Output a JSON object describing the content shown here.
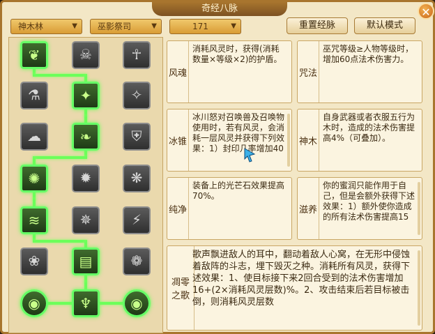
{
  "title": "奇经八脉",
  "dropdowns": [
    {
      "value": "神木林"
    },
    {
      "value": "巫影祭司"
    },
    {
      "value": "171"
    }
  ],
  "buttons": {
    "reset": "重置经脉",
    "default": "默认模式"
  },
  "skills": [
    {
      "name": "风魂",
      "desc": "消耗风灵时，获得(消耗数量×等级×2)的护盾。"
    },
    {
      "name": "咒法",
      "desc": "巫咒等级≥人物等级时，增加60点法术伤害力。"
    },
    {
      "name": "冰锥",
      "desc": "冰川怒对召唤兽及召唤物使用时，若有风灵，会消耗一层风灵并获得下列效果：1）封印几率增加40"
    },
    {
      "name": "神木",
      "desc": "自身武器或者衣服五行为木时，造成的法术伤害提高4%（可叠加）。"
    },
    {
      "name": "纯净",
      "desc": "装备上的光芒石效果提高70%。"
    },
    {
      "name": "滋养",
      "desc": "你的蜜润只能作用于自己，但是会额外获得下述效果：1）额外使你造成的所有法术伤害提高15"
    },
    {
      "name": "凋零之歌",
      "desc": "歌声飘进敌人的耳中，翻动着敌人心窝，在无形中侵蚀着敌阵的斗志，埋下毁灭之种。消耗所有风灵，获得下述效果：1、使目标接下来2回合受到的法术伤害增加16+(2×消耗风灵层数)%。2、攻击结束后若目标被击倒，则消耗风灵层数"
    }
  ],
  "tree_icons": [
    "leaf-swirl",
    "demon-mask",
    "meditate",
    "potion",
    "wind-blade",
    "dragon-claw",
    "cloud-swirl",
    "leaf-bird",
    "shield-hand",
    "tornado",
    "spike-ring",
    "fire-flower",
    "water-wave",
    "web-bomb",
    "cracked-stone",
    "lotus-fan",
    "green-box",
    "dark-leaf",
    "orb-left",
    "tree-man",
    "orb-right"
  ],
  "tree_active": [
    0,
    4,
    7,
    9,
    12,
    16,
    18,
    19,
    20
  ]
}
